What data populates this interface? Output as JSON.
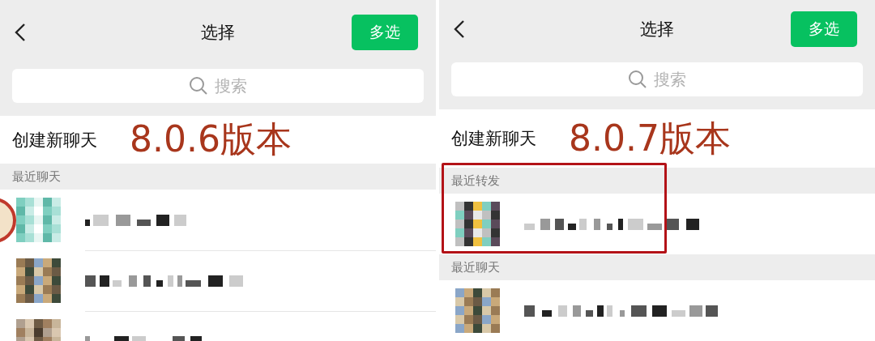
{
  "panels": [
    {
      "title": "选择",
      "button": "多选",
      "search": {
        "placeholder": "搜索"
      },
      "create_chat": "创建新聊天",
      "version_label": "8.0.6版本",
      "sticker": true,
      "sections": [
        {
          "title": "最近聊天",
          "highlighted": false,
          "rows": [
            {
              "kind": "contact"
            },
            {
              "kind": "contact"
            },
            {
              "kind": "contact"
            }
          ]
        }
      ]
    },
    {
      "title": "选择",
      "button": "多选",
      "search": {
        "placeholder": "搜索"
      },
      "create_chat": "创建新聊天",
      "version_label": "8.0.7版本",
      "sections": [
        {
          "title": "最近转发",
          "highlighted": true,
          "rows": [
            {
              "kind": "contact"
            }
          ]
        },
        {
          "title": "最近聊天",
          "highlighted": false,
          "rows": [
            {
              "kind": "contact"
            }
          ]
        }
      ]
    }
  ]
}
